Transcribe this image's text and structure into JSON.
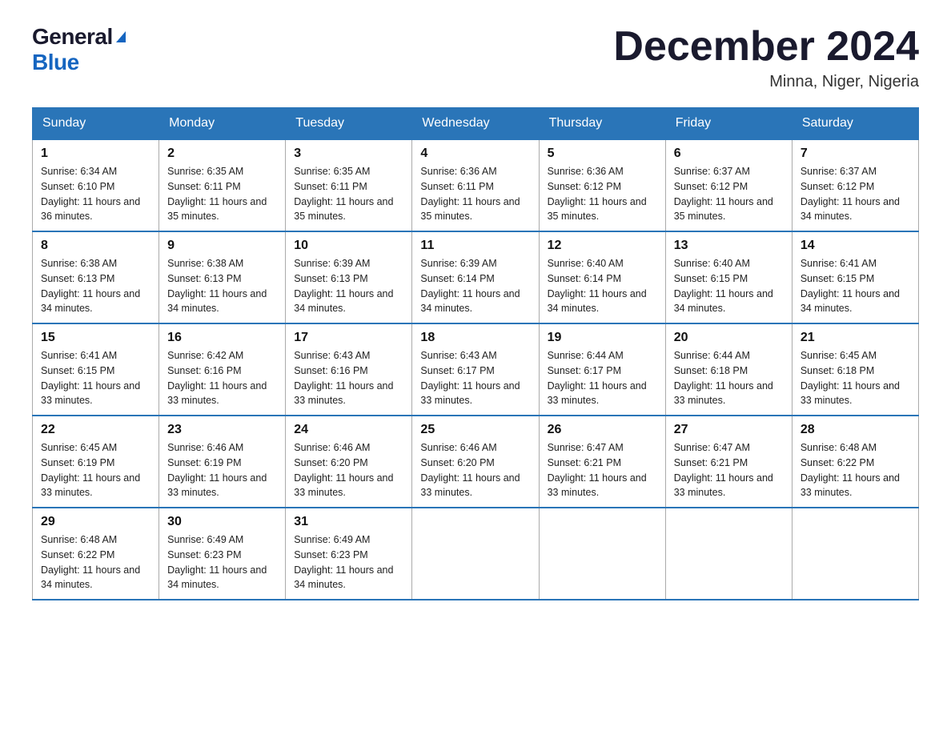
{
  "logo": {
    "general": "General",
    "blue": "Blue"
  },
  "title": "December 2024",
  "location": "Minna, Niger, Nigeria",
  "days_of_week": [
    "Sunday",
    "Monday",
    "Tuesday",
    "Wednesday",
    "Thursday",
    "Friday",
    "Saturday"
  ],
  "weeks": [
    [
      {
        "day": "1",
        "sunrise": "6:34 AM",
        "sunset": "6:10 PM",
        "daylight": "11 hours and 36 minutes."
      },
      {
        "day": "2",
        "sunrise": "6:35 AM",
        "sunset": "6:11 PM",
        "daylight": "11 hours and 35 minutes."
      },
      {
        "day": "3",
        "sunrise": "6:35 AM",
        "sunset": "6:11 PM",
        "daylight": "11 hours and 35 minutes."
      },
      {
        "day": "4",
        "sunrise": "6:36 AM",
        "sunset": "6:11 PM",
        "daylight": "11 hours and 35 minutes."
      },
      {
        "day": "5",
        "sunrise": "6:36 AM",
        "sunset": "6:12 PM",
        "daylight": "11 hours and 35 minutes."
      },
      {
        "day": "6",
        "sunrise": "6:37 AM",
        "sunset": "6:12 PM",
        "daylight": "11 hours and 35 minutes."
      },
      {
        "day": "7",
        "sunrise": "6:37 AM",
        "sunset": "6:12 PM",
        "daylight": "11 hours and 34 minutes."
      }
    ],
    [
      {
        "day": "8",
        "sunrise": "6:38 AM",
        "sunset": "6:13 PM",
        "daylight": "11 hours and 34 minutes."
      },
      {
        "day": "9",
        "sunrise": "6:38 AM",
        "sunset": "6:13 PM",
        "daylight": "11 hours and 34 minutes."
      },
      {
        "day": "10",
        "sunrise": "6:39 AM",
        "sunset": "6:13 PM",
        "daylight": "11 hours and 34 minutes."
      },
      {
        "day": "11",
        "sunrise": "6:39 AM",
        "sunset": "6:14 PM",
        "daylight": "11 hours and 34 minutes."
      },
      {
        "day": "12",
        "sunrise": "6:40 AM",
        "sunset": "6:14 PM",
        "daylight": "11 hours and 34 minutes."
      },
      {
        "day": "13",
        "sunrise": "6:40 AM",
        "sunset": "6:15 PM",
        "daylight": "11 hours and 34 minutes."
      },
      {
        "day": "14",
        "sunrise": "6:41 AM",
        "sunset": "6:15 PM",
        "daylight": "11 hours and 34 minutes."
      }
    ],
    [
      {
        "day": "15",
        "sunrise": "6:41 AM",
        "sunset": "6:15 PM",
        "daylight": "11 hours and 33 minutes."
      },
      {
        "day": "16",
        "sunrise": "6:42 AM",
        "sunset": "6:16 PM",
        "daylight": "11 hours and 33 minutes."
      },
      {
        "day": "17",
        "sunrise": "6:43 AM",
        "sunset": "6:16 PM",
        "daylight": "11 hours and 33 minutes."
      },
      {
        "day": "18",
        "sunrise": "6:43 AM",
        "sunset": "6:17 PM",
        "daylight": "11 hours and 33 minutes."
      },
      {
        "day": "19",
        "sunrise": "6:44 AM",
        "sunset": "6:17 PM",
        "daylight": "11 hours and 33 minutes."
      },
      {
        "day": "20",
        "sunrise": "6:44 AM",
        "sunset": "6:18 PM",
        "daylight": "11 hours and 33 minutes."
      },
      {
        "day": "21",
        "sunrise": "6:45 AM",
        "sunset": "6:18 PM",
        "daylight": "11 hours and 33 minutes."
      }
    ],
    [
      {
        "day": "22",
        "sunrise": "6:45 AM",
        "sunset": "6:19 PM",
        "daylight": "11 hours and 33 minutes."
      },
      {
        "day": "23",
        "sunrise": "6:46 AM",
        "sunset": "6:19 PM",
        "daylight": "11 hours and 33 minutes."
      },
      {
        "day": "24",
        "sunrise": "6:46 AM",
        "sunset": "6:20 PM",
        "daylight": "11 hours and 33 minutes."
      },
      {
        "day": "25",
        "sunrise": "6:46 AM",
        "sunset": "6:20 PM",
        "daylight": "11 hours and 33 minutes."
      },
      {
        "day": "26",
        "sunrise": "6:47 AM",
        "sunset": "6:21 PM",
        "daylight": "11 hours and 33 minutes."
      },
      {
        "day": "27",
        "sunrise": "6:47 AM",
        "sunset": "6:21 PM",
        "daylight": "11 hours and 33 minutes."
      },
      {
        "day": "28",
        "sunrise": "6:48 AM",
        "sunset": "6:22 PM",
        "daylight": "11 hours and 33 minutes."
      }
    ],
    [
      {
        "day": "29",
        "sunrise": "6:48 AM",
        "sunset": "6:22 PM",
        "daylight": "11 hours and 34 minutes."
      },
      {
        "day": "30",
        "sunrise": "6:49 AM",
        "sunset": "6:23 PM",
        "daylight": "11 hours and 34 minutes."
      },
      {
        "day": "31",
        "sunrise": "6:49 AM",
        "sunset": "6:23 PM",
        "daylight": "11 hours and 34 minutes."
      },
      null,
      null,
      null,
      null
    ]
  ]
}
